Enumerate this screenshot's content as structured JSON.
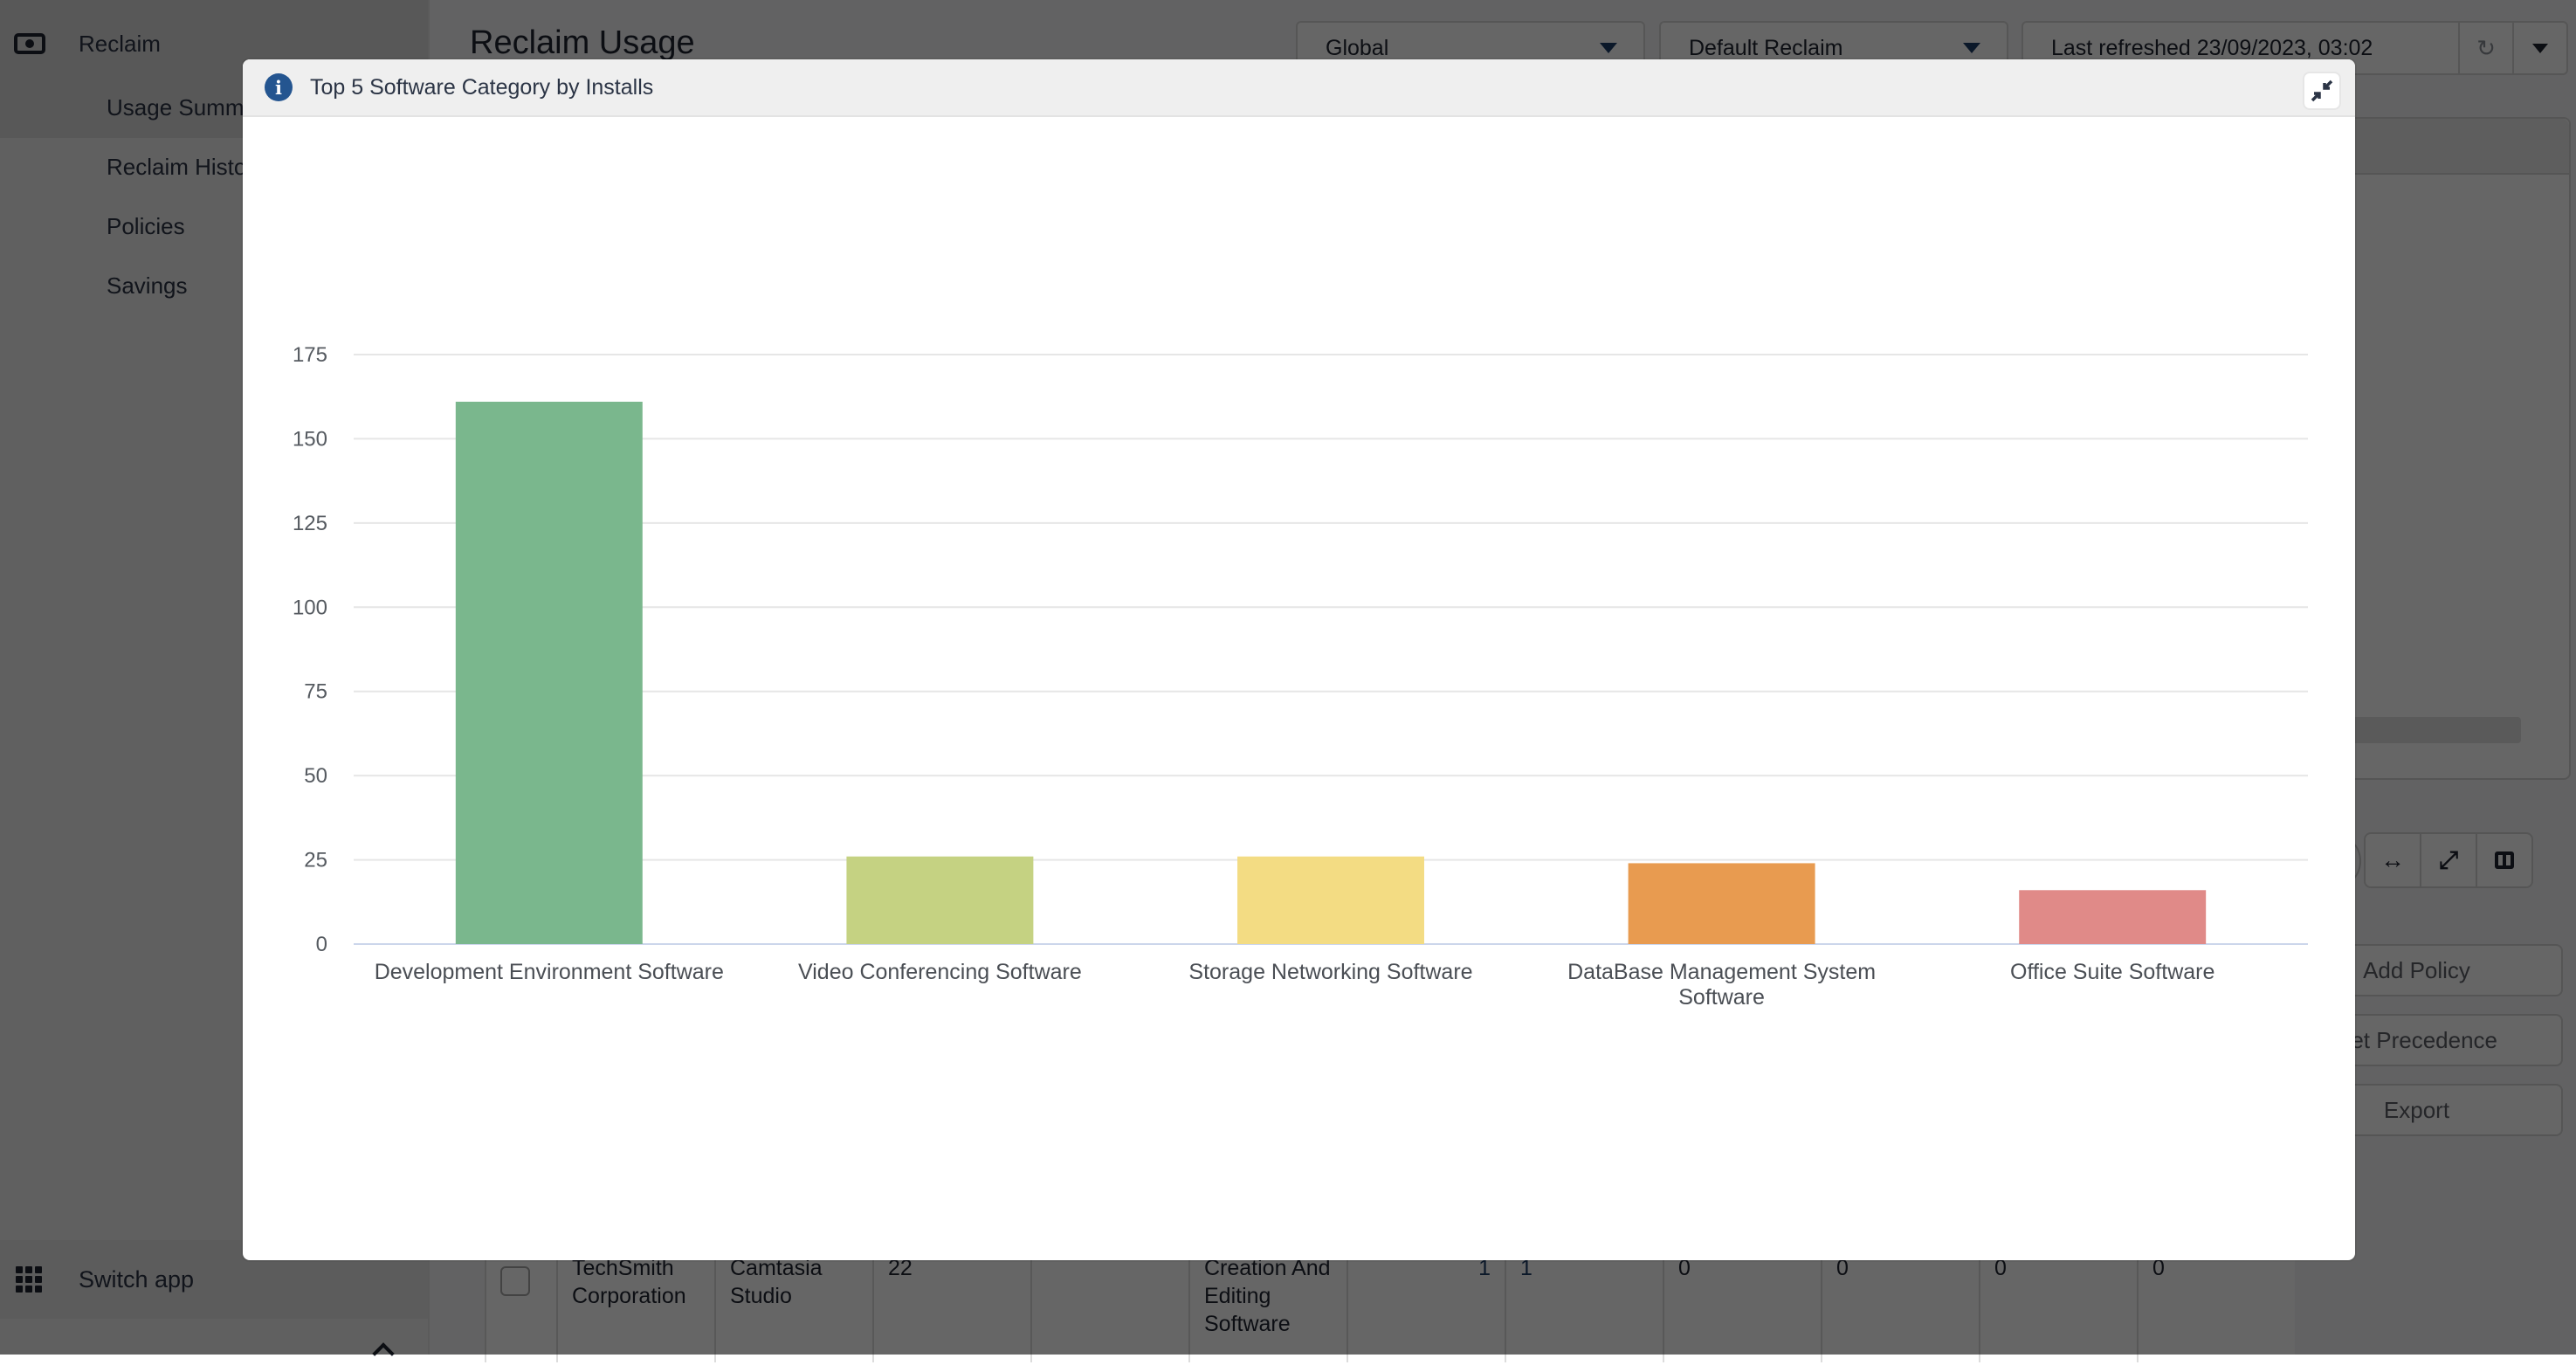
{
  "sidebar": {
    "app_name": "Reclaim",
    "app_icon": "money-bill-icon",
    "items": [
      {
        "label": "Usage Summary"
      },
      {
        "label": "Reclaim History"
      },
      {
        "label": "Policies"
      },
      {
        "label": "Savings"
      }
    ],
    "switch_app_label": "Switch app",
    "switch_app_icon": "grid-icon"
  },
  "main": {
    "title": "Reclaim Usage",
    "scope_dropdown": {
      "value": "Global"
    },
    "policy_dropdown": {
      "value": "Default Reclaim"
    },
    "last_refreshed": "Last refreshed 23/09/2023, 03:02",
    "refresh_icon": "refresh-icon",
    "actions": [
      "Add Policy",
      "Set Precedence",
      "Export"
    ],
    "view_toggles": [
      "fit-width-icon",
      "expand-icon",
      "split-view-icon"
    ],
    "table_row": {
      "publisher": "TechSmith Corporation",
      "product": "Camtasia Studio",
      "installs": "22",
      "empty": "",
      "category": "Creation And Editing Software",
      "val1": "1",
      "val2": "1",
      "val3": "0",
      "val4": "0",
      "val5": "0",
      "val6": "0"
    }
  },
  "modal": {
    "title": "Top 5 Software Category by Installs",
    "info_icon": "info-icon",
    "collapse_icon": "compress-icon"
  },
  "chart_data": {
    "type": "bar",
    "title": "Top 5 Software Category by Installs",
    "xlabel": "",
    "ylabel": "",
    "categories": [
      "Development Environment Software",
      "Video Conferencing Software",
      "Storage Networking Software",
      "DataBase Management System Software",
      "Office Suite Software"
    ],
    "values": [
      161,
      26,
      26,
      24,
      16
    ],
    "colors": [
      "#7ab78d",
      "#c5d282",
      "#f3dc83",
      "#e89b50",
      "#e08a88"
    ],
    "ylim": [
      0,
      175
    ],
    "yticks": [
      0,
      25,
      50,
      75,
      100,
      125,
      150,
      175
    ],
    "grid": true,
    "legend": "none"
  }
}
